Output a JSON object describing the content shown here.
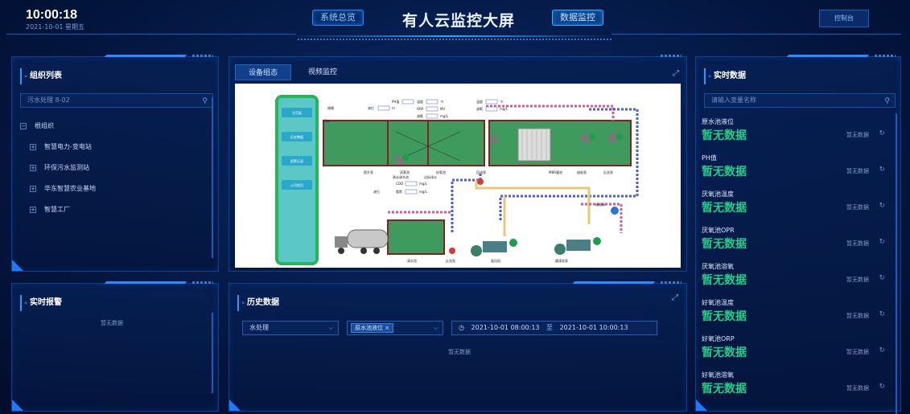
{
  "header": {
    "time": "10:00:18",
    "date": "2021-10-01 星期五",
    "nav_overview": "系统总览",
    "title": "有人云监控大屏",
    "nav_monitor": "数据监控",
    "console": "控制台"
  },
  "org": {
    "title": "组织列表",
    "search_value": "污水处理 8-02",
    "root": "根组织",
    "root_toggle": "−",
    "items": [
      {
        "label": "智慧电力-变电站",
        "toggle": "+"
      },
      {
        "label": "环保污水监测站",
        "toggle": "+"
      },
      {
        "label": "华东智慧农业基地",
        "toggle": "+"
      },
      {
        "label": "智慧工厂",
        "toggle": "+"
      }
    ]
  },
  "alarm": {
    "title": "实时报警",
    "empty": "暂无数据"
  },
  "center": {
    "tabs": [
      "设备组态",
      "视频监控"
    ],
    "expand_icon": "⤢"
  },
  "diagram": {
    "side_buttons": [
      "主页面",
      "历史数据",
      "报警记录",
      "公司首页"
    ],
    "labels": {
      "grille": "格栅",
      "inlet": "污水",
      "ph": "PH值",
      "temp": "温度",
      "orp": "ORP",
      "do": "溶氧",
      "cod": "COD",
      "ammonia": "氨氮",
      "level": "液位",
      "mv": "MV",
      "c_unit": "℃",
      "mgl": "mg/L",
      "m_unit": "m",
      "lift": "提升泵",
      "anoxic": "厌氧池",
      "aerobic": "好氧池",
      "reflux": "回流泵",
      "mbr": "MBR膜池",
      "suction": "抽吸泵",
      "backwash": "反洗泵",
      "raw_flow": "原水调节池",
      "discharge": "达标排水",
      "clean": "清水池",
      "blower": "鼓风机",
      "wash_pump": "膜清洗泵",
      "valve": "抽吸阀"
    }
  },
  "history": {
    "title": "历史数据",
    "select1": "水处理",
    "chip": "原水池液位",
    "date_from": "2021-10-01 08:00:13",
    "to": "至",
    "date_to": "2021-10-01 10:00:13",
    "empty": "暂无数据",
    "clock_icon": "◷"
  },
  "realtime": {
    "title": "实时数据",
    "search_placeholder": "请输入变量名称",
    "items": [
      {
        "name": "原水池液位",
        "value": "暂无数据",
        "status": "暂无数据"
      },
      {
        "name": "PH值",
        "value": "暂无数据",
        "status": "暂无数据"
      },
      {
        "name": "厌氧池温度",
        "value": "暂无数据",
        "status": "暂无数据"
      },
      {
        "name": "厌氧池OPR",
        "value": "暂无数据",
        "status": "暂无数据"
      },
      {
        "name": "厌氧池溶氧",
        "value": "暂无数据",
        "status": "暂无数据"
      },
      {
        "name": "好氧池温度",
        "value": "暂无数据",
        "status": "暂无数据"
      },
      {
        "name": "好氧池ORP",
        "value": "暂无数据",
        "status": "暂无数据"
      },
      {
        "name": "好氧池溶氧",
        "value": "暂无数据",
        "status": "暂无数据"
      }
    ]
  },
  "colors": {
    "accent": "#2a8cff",
    "value_green": "#1fd08a",
    "panel_border": "#123f86"
  }
}
